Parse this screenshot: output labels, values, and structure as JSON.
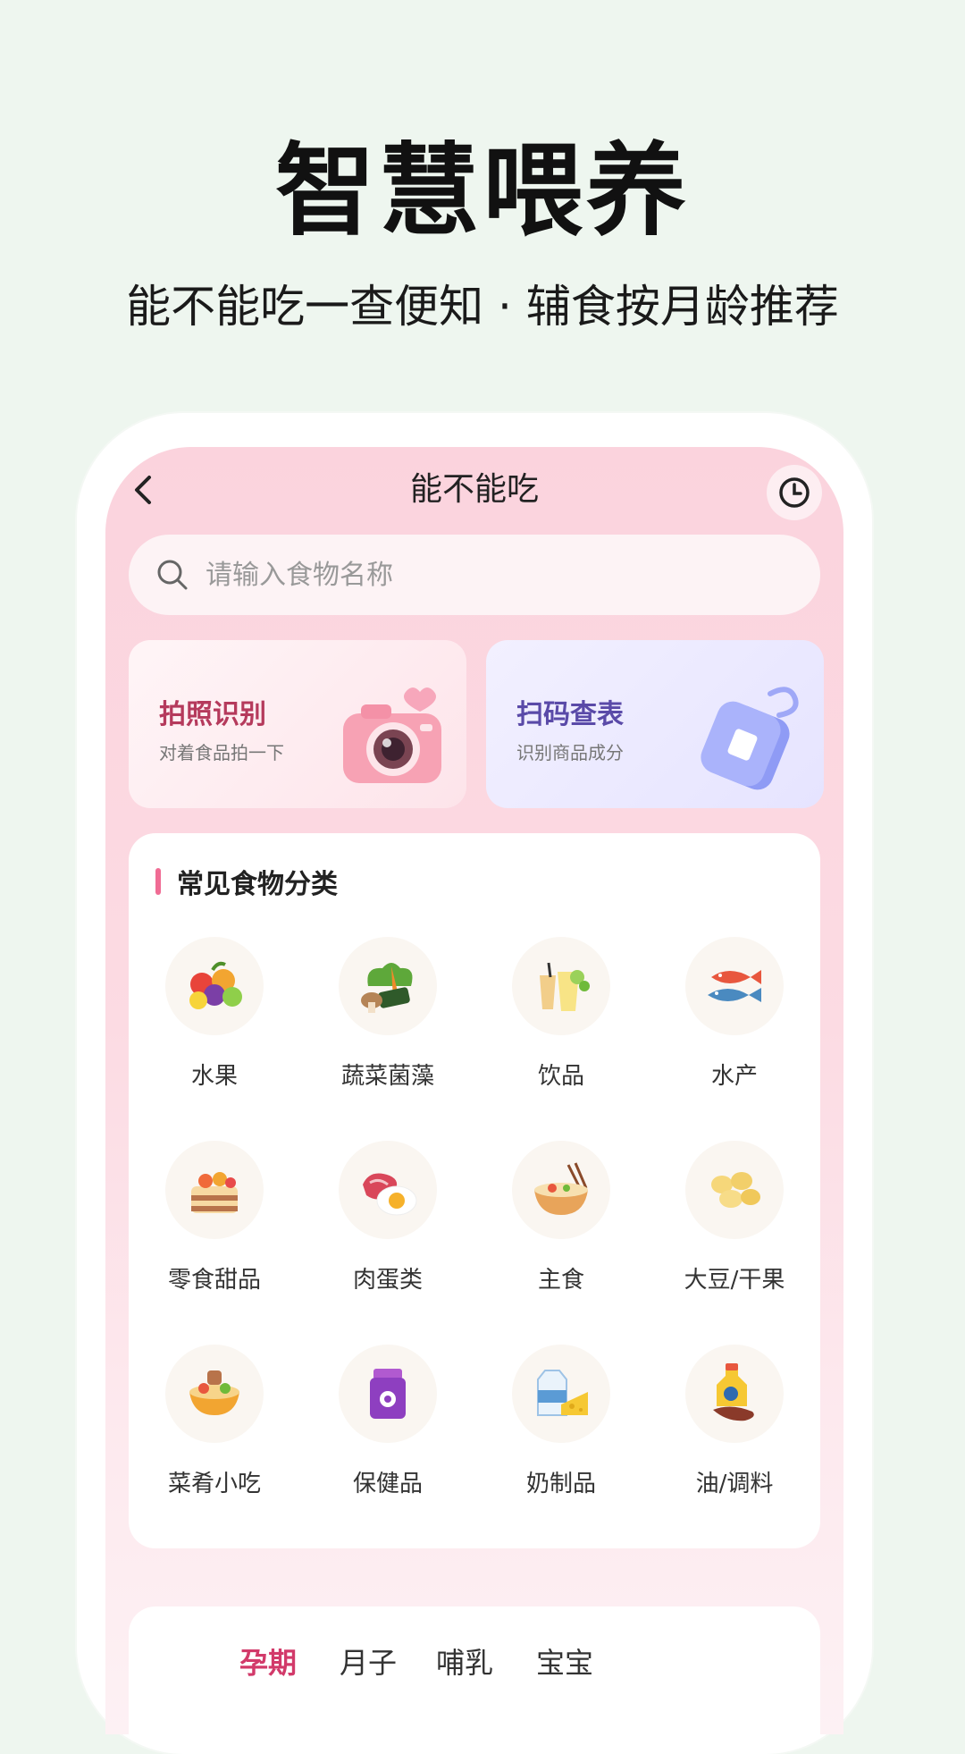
{
  "hero": {
    "title": "智慧喂养",
    "subtitle": "能不能吃一查便知 · 辅食按月龄推荐"
  },
  "nav": {
    "title": "能不能吃",
    "back_icon": "chevron-left-icon",
    "history_icon": "clock-icon"
  },
  "search": {
    "placeholder": "请输入食物名称",
    "icon": "search-icon"
  },
  "cards": {
    "photo": {
      "title": "拍照识别",
      "subtitle": "对着食品拍一下"
    },
    "scan": {
      "title": "扫码查表",
      "subtitle": "识别商品成分"
    }
  },
  "categories": {
    "title": "常见食物分类",
    "items": [
      {
        "label": "水果",
        "icon": "fruit-icon"
      },
      {
        "label": "蔬菜菌藻",
        "icon": "vegetable-icon"
      },
      {
        "label": "饮品",
        "icon": "drink-icon"
      },
      {
        "label": "水产",
        "icon": "fish-icon"
      },
      {
        "label": "零食甜品",
        "icon": "cake-icon"
      },
      {
        "label": "肉蛋类",
        "icon": "meat-egg-icon"
      },
      {
        "label": "主食",
        "icon": "noodle-bowl-icon"
      },
      {
        "label": "大豆/干果",
        "icon": "bean-icon"
      },
      {
        "label": "菜肴小吃",
        "icon": "dish-icon"
      },
      {
        "label": "保健品",
        "icon": "supplement-icon"
      },
      {
        "label": "奶制品",
        "icon": "milk-cheese-icon"
      },
      {
        "label": "油/调料",
        "icon": "oil-spice-icon"
      }
    ]
  },
  "tabs": [
    {
      "label": "孕期",
      "active": true
    },
    {
      "label": "月子",
      "active": false
    },
    {
      "label": "哺乳",
      "active": false
    },
    {
      "label": "宝宝",
      "active": false
    }
  ],
  "colors": {
    "accent": "#d23a6a",
    "screen_bg": "#fbd3dd",
    "page_bg": "#eef6ef"
  }
}
